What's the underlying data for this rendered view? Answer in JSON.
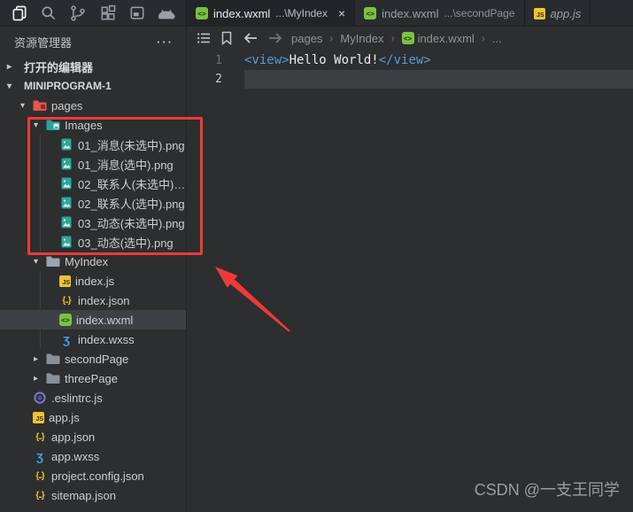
{
  "activity_bar": {
    "icons": [
      "files-icon",
      "search-icon",
      "source-control-icon",
      "extensions-icon",
      "window-icon",
      "cat-icon"
    ]
  },
  "tabs": [
    {
      "label": "index.wxml",
      "description": "...\\MyIndex",
      "icon": "wxml",
      "active": true,
      "preview": false,
      "close_label": "×"
    },
    {
      "label": "index.wxml",
      "description": "...\\secondPage",
      "icon": "wxml",
      "active": false,
      "preview": false
    },
    {
      "label": "app.js",
      "description": "",
      "icon": "js",
      "active": false,
      "preview": true
    }
  ],
  "breadcrumb": {
    "items": [
      {
        "label": "pages"
      },
      {
        "label": "MyIndex"
      },
      {
        "label": "index.wxml",
        "icon": "wxml"
      },
      {
        "label": "..."
      }
    ],
    "separator": "›"
  },
  "editor": {
    "lines": [
      {
        "number": "1",
        "active": false,
        "segments": [
          {
            "text": "<view>",
            "type": "tag"
          },
          {
            "text": "Hello World!",
            "type": "text"
          },
          {
            "text": "</view>",
            "type": "tag"
          }
        ]
      },
      {
        "number": "2",
        "active": true,
        "segments": []
      }
    ]
  },
  "sidebar": {
    "title": "资源管理器",
    "actions_label": "···",
    "tree": [
      {
        "label": "打开的编辑器",
        "depth": 0,
        "chevron": "collapsed",
        "section": true
      },
      {
        "label": "MINIPROGRAM-1",
        "depth": 0,
        "chevron": "expanded",
        "section": true,
        "bold": true
      },
      {
        "label": "pages",
        "depth": 1,
        "chevron": "expanded",
        "icon": "folder-pages"
      },
      {
        "label": "Images",
        "depth": 2,
        "chevron": "expanded",
        "icon": "folder-images"
      },
      {
        "label": "01_消息(未选中).png",
        "depth": 3,
        "icon": "image"
      },
      {
        "label": "01_消息(选中).png",
        "depth": 3,
        "icon": "image"
      },
      {
        "label": "02_联系人(未选中).p...",
        "depth": 3,
        "icon": "image"
      },
      {
        "label": "02_联系人(选中).png",
        "depth": 3,
        "icon": "image"
      },
      {
        "label": "03_动态(未选中).png",
        "depth": 3,
        "icon": "image"
      },
      {
        "label": "03_动态(选中).png",
        "depth": 3,
        "icon": "image"
      },
      {
        "label": "MyIndex",
        "depth": 2,
        "chevron": "expanded",
        "icon": "folder-open"
      },
      {
        "label": "index.js",
        "depth": 3,
        "icon": "js"
      },
      {
        "label": "index.json",
        "depth": 3,
        "icon": "json"
      },
      {
        "label": "index.wxml",
        "depth": 3,
        "icon": "wxml",
        "selected": true
      },
      {
        "label": "index.wxss",
        "depth": 3,
        "icon": "wxss"
      },
      {
        "label": "secondPage",
        "depth": 2,
        "chevron": "collapsed",
        "icon": "folder"
      },
      {
        "label": "threePage",
        "depth": 2,
        "chevron": "collapsed",
        "icon": "folder"
      },
      {
        "label": ".eslintrc.js",
        "depth": 1,
        "icon": "eslint"
      },
      {
        "label": "app.js",
        "depth": 1,
        "icon": "js"
      },
      {
        "label": "app.json",
        "depth": 1,
        "icon": "json"
      },
      {
        "label": "app.wxss",
        "depth": 1,
        "icon": "wxss"
      },
      {
        "label": "project.config.json",
        "depth": 1,
        "icon": "json"
      },
      {
        "label": "sitemap.json",
        "depth": 1,
        "icon": "json"
      }
    ]
  },
  "annotations": {
    "box_color": "#ef3a36",
    "arrow_color": "#ef3a36"
  },
  "watermark": "CSDN @一支王同学"
}
